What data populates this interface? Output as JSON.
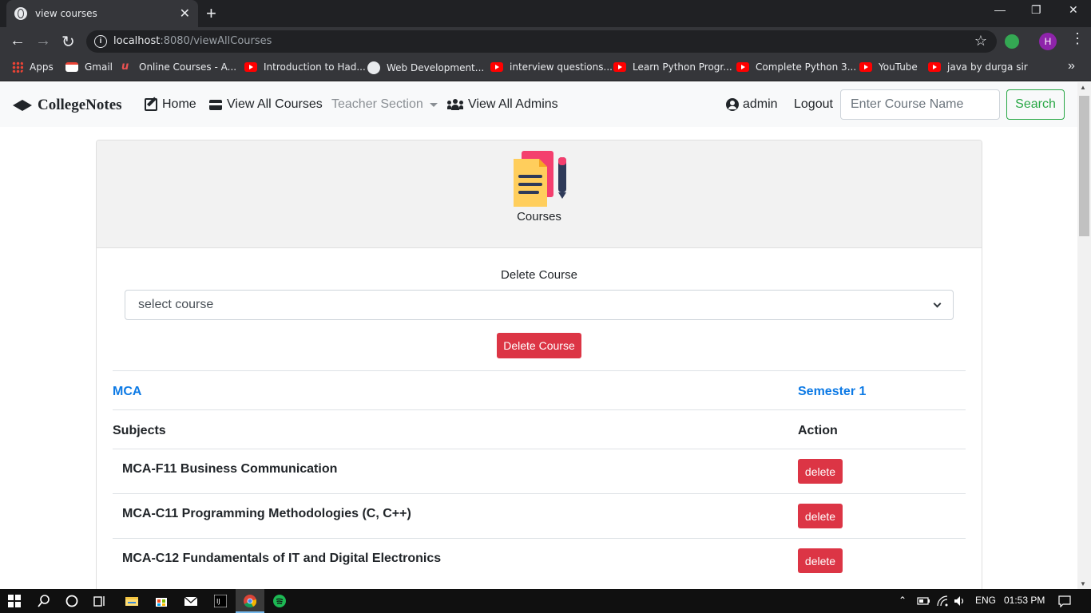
{
  "browser": {
    "tab_title": "view courses",
    "url_host": "localhost",
    "url_rest": ":8080/viewAllCourses",
    "profile_initial": "H",
    "bookmarks": [
      {
        "label": "Apps",
        "icon": "apps-icon"
      },
      {
        "label": "Gmail",
        "icon": "gmail-icon"
      },
      {
        "label": "Online Courses - A...",
        "icon": "udemy-icon"
      },
      {
        "label": "Introduction to Had...",
        "icon": "youtube-icon"
      },
      {
        "label": "Web Development...",
        "icon": "web-icon"
      },
      {
        "label": "interview questions...",
        "icon": "youtube-icon"
      },
      {
        "label": "Learn Python Progr...",
        "icon": "youtube-icon"
      },
      {
        "label": "Complete Python 3...",
        "icon": "youtube-icon"
      },
      {
        "label": "YouTube",
        "icon": "youtube-icon"
      },
      {
        "label": "java by durga sir",
        "icon": "youtube-icon"
      }
    ]
  },
  "navbar": {
    "brand": "CollegeNotes",
    "home": "Home",
    "view_courses": "View All Courses",
    "teacher_section": "Teacher Section",
    "view_admins": "View All Admins",
    "user": "admin",
    "logout": "Logout",
    "search_placeholder": "Enter Course Name",
    "search_button": "Search"
  },
  "card": {
    "title": "Courses",
    "delete_label": "Delete Course",
    "select_value": "select course",
    "delete_button": "Delete Course",
    "course": "MCA",
    "semester": "Semester 1",
    "col_subjects": "Subjects",
    "col_action": "Action",
    "subjects": [
      {
        "name": "MCA-F11 Business Communication",
        "action": "delete"
      },
      {
        "name": "MCA-C11 Programming Methodologies (C, C++)",
        "action": "delete"
      },
      {
        "name": "MCA-C12 Fundamentals of IT and Digital Electronics",
        "action": "delete"
      }
    ]
  },
  "taskbar": {
    "language": "ENG",
    "time": "01:53 PM"
  },
  "colors": {
    "danger": "#dc3545",
    "success": "#28a745",
    "link": "#0d7ae5"
  }
}
